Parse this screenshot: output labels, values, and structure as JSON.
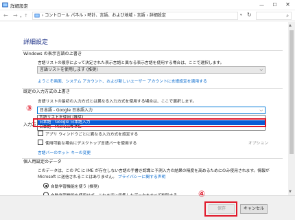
{
  "window": {
    "title": "詳細設定",
    "min": "—",
    "max": "☐",
    "close": "✕"
  },
  "address": {
    "breadcrumb": "› コントロール パネル  ›  時計、言語、および地域  ›  言語  ›  詳細設定",
    "search_icon": "⌕"
  },
  "heading": "詳細設定",
  "override_display": {
    "title": "Windows の表示言語の上書き",
    "desc": "言語リストの順序によって決定された表示言語と異なる表示言語を使用する場合は、ここで選択します。",
    "selected": "言語リストを使用します (推奨)",
    "link": "ようこそ画面、システム アカウント、および新しいユーザー アカウントに言語設定を適用する"
  },
  "override_input": {
    "title": "既定の入力方式の上書き",
    "desc": "言語リストの最初の入力方式とは異なる入力方式を使用する場合は、ここで選択します。",
    "selected": "日本語 - Google 日本語入力",
    "options": [
      "言語リストを使用 (推奨)",
      "日本語 - Google 日本語入力",
      "日本語 - Microsoft IME"
    ]
  },
  "switch_input": {
    "label_partial": "入力方",
    "checkbox1": "アプリ ウィンドウごとに異なる入力方式を設定する",
    "checkbox2": "使用可能な場合にデスクトップ言語バーを使用する",
    "options_link": "オプション",
    "hotkey_link": "言語バーのホット キーの変更"
  },
  "personal": {
    "title": "個人用設定のデータ",
    "desc1": "このデータは、この PC に IME が存在しない言語の手書き認識と予測入力の結果の精度を高めるためにのみ使用されます。情報が",
    "desc2": "Microsoft に送信されることはありません。",
    "privacy_link": "プライバシーに関する声明",
    "radio1": "自動学習機能を使う (推奨)",
    "radio2": "自動学習機能を使用せず、これまでに収集したデータをすべて削除する"
  },
  "markers": {
    "m3": "③",
    "m4": "④"
  },
  "footer": {
    "save": "保存",
    "cancel": "キャンセル"
  }
}
